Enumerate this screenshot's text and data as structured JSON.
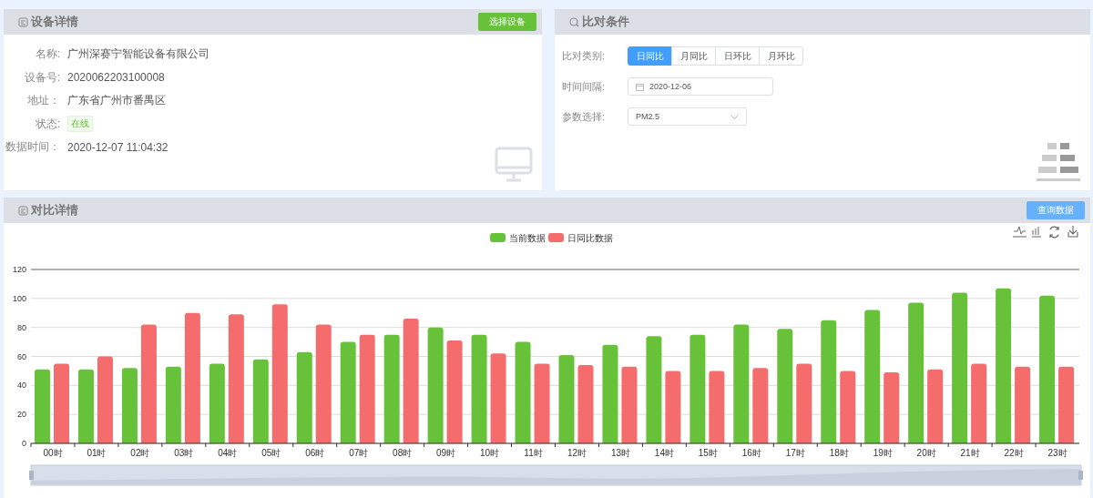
{
  "device_panel": {
    "title": "设备详情",
    "button": "选择设备",
    "fields": [
      {
        "label": "名称:",
        "value": "广州深赛宁智能设备有限公司",
        "kind": "text"
      },
      {
        "label": "设备号:",
        "value": "2020062203100008",
        "kind": "text"
      },
      {
        "label": "地址：",
        "value": "广东省广州市番禺区",
        "kind": "text"
      },
      {
        "label": "状态:",
        "value": "在线",
        "kind": "tag"
      },
      {
        "label": "数据时间：",
        "value": "2020-12-07 11:04:32",
        "kind": "text"
      }
    ]
  },
  "compare_panel": {
    "title": "比对条件",
    "category_label": "比对类别:",
    "categories": [
      {
        "label": "日同比",
        "selected": true
      },
      {
        "label": "月同比",
        "selected": false
      },
      {
        "label": "日环比",
        "selected": false
      },
      {
        "label": "月环比",
        "selected": false
      }
    ],
    "date_label": "时间间隔:",
    "date_value": "2020-12-06",
    "param_label": "参数选择:",
    "param_value": "PM2.5"
  },
  "detail_panel": {
    "title": "对比详情",
    "button": "查询数据",
    "chart_data": {
      "type": "bar",
      "categories": [
        "00时",
        "01时",
        "02时",
        "03时",
        "04时",
        "05时",
        "06时",
        "07时",
        "08时",
        "09时",
        "10时",
        "11时",
        "12时",
        "13时",
        "14时",
        "15时",
        "16时",
        "17时",
        "18时",
        "19时",
        "20时",
        "21时",
        "22时",
        "23时"
      ],
      "series": [
        {
          "name": "当前数据",
          "color": "#67c23a",
          "values": [
            51,
            51,
            52,
            53,
            55,
            58,
            63,
            70,
            75,
            80,
            75,
            70,
            61,
            68,
            74,
            75,
            82,
            79,
            85,
            92,
            97,
            104,
            107,
            102
          ]
        },
        {
          "name": "日同比数据",
          "color": "#f56c6c",
          "values": [
            55,
            60,
            82,
            90,
            89,
            96,
            82,
            75,
            86,
            71,
            62,
            55,
            54,
            53,
            50,
            50,
            52,
            55,
            50,
            49,
            51,
            55,
            53,
            53
          ]
        }
      ],
      "grid": true,
      "legend": true,
      "ylim": [
        0,
        120
      ],
      "yticks": [
        0,
        20,
        40,
        60,
        80,
        100,
        120
      ]
    }
  }
}
